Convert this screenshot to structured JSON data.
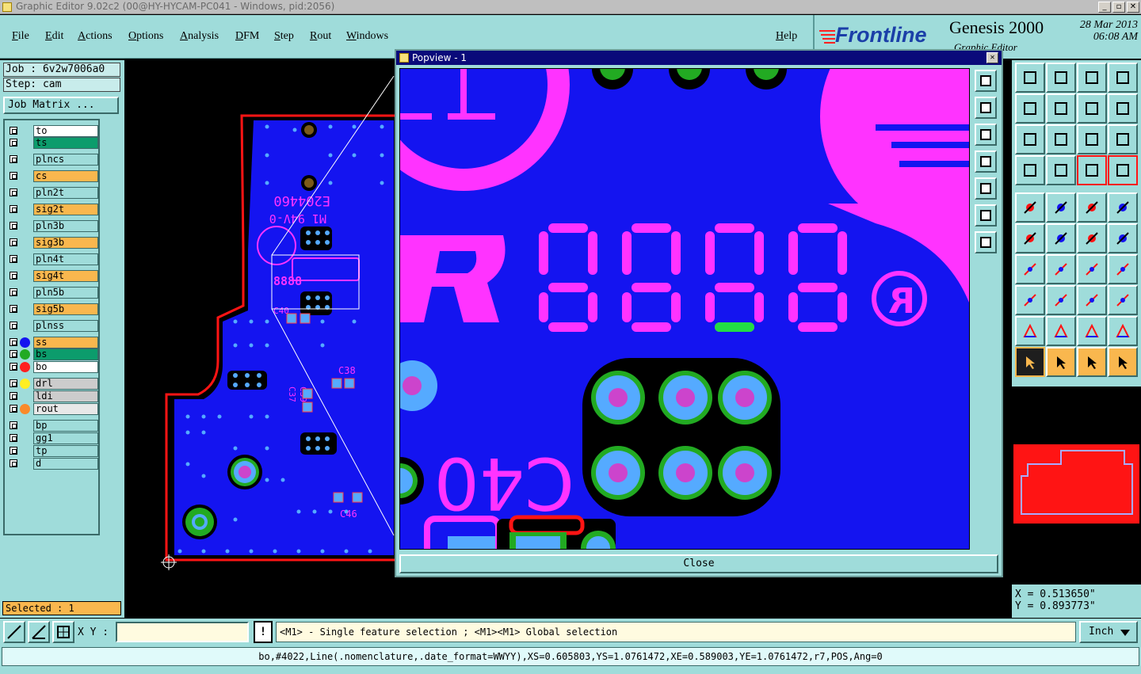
{
  "window": {
    "title": "Graphic Editor 9.02c2 (00@HY-HYCAM-PC041 - Windows, pid:2056)"
  },
  "menu": {
    "items": [
      "File",
      "Edit",
      "Actions",
      "Options",
      "Analysis",
      "DFM",
      "Step",
      "Rout",
      "Windows"
    ],
    "help": "Help"
  },
  "brand": {
    "logo": "Frontline",
    "product": "Genesis 2000",
    "subtitle": "Graphic Editor",
    "date": "28 Mar 2013",
    "time": "06:08 AM"
  },
  "job": {
    "job_label": "Job : 6v2w7006a0",
    "step_label": "Step: cam",
    "matrix_button": "Job Matrix ..."
  },
  "layers": [
    {
      "name": "to",
      "color": "#ffffff",
      "dot": null
    },
    {
      "name": "ts",
      "color": "#0c9c6c",
      "dot": null
    },
    {
      "name": "plncs",
      "color": "#9fdcda",
      "dot": null
    },
    {
      "name": "cs",
      "color": "#f9b74e",
      "dot": null
    },
    {
      "name": "pln2t",
      "color": "#9fdcda",
      "dot": null
    },
    {
      "name": "sig2t",
      "color": "#f9b74e",
      "dot": null
    },
    {
      "name": "pln3b",
      "color": "#9fdcda",
      "dot": null
    },
    {
      "name": "sig3b",
      "color": "#f9b74e",
      "dot": null
    },
    {
      "name": "pln4t",
      "color": "#9fdcda",
      "dot": null
    },
    {
      "name": "sig4t",
      "color": "#f9b74e",
      "dot": null
    },
    {
      "name": "pln5b",
      "color": "#9fdcda",
      "dot": null
    },
    {
      "name": "sig5b",
      "color": "#f9b74e",
      "dot": null
    },
    {
      "name": "plnss",
      "color": "#9fdcda",
      "dot": null
    },
    {
      "name": "ss",
      "color": "#f9b74e",
      "dot": "#1414f0"
    },
    {
      "name": "bs",
      "color": "#0c9c6c",
      "dot": "#22aa22"
    },
    {
      "name": "bo",
      "color": "#ffffff",
      "dot": "#ff2020"
    },
    {
      "name": "drl",
      "color": "#cccccc",
      "dot": "#ffee22"
    },
    {
      "name": "ldi",
      "color": "#cccccc",
      "dot": null
    },
    {
      "name": "rout",
      "color": "#e8e8e8",
      "dot": "#f98a2a"
    },
    {
      "name": "bp",
      "color": "#9fdcda",
      "dot": null
    },
    {
      "name": "gg1",
      "color": "#9fdcda",
      "dot": null
    },
    {
      "name": "tp",
      "color": "#9fdcda",
      "dot": null
    },
    {
      "name": "d",
      "color": "#9fdcda",
      "dot": null
    }
  ],
  "selection": {
    "label": "Selected : 1"
  },
  "popview": {
    "title": "Popview - 1",
    "close_label": "Close"
  },
  "coords": {
    "x": "X = 0.513650\"",
    "y": "Y = 0.893773\""
  },
  "bottom": {
    "xy_label": "X Y :",
    "xy_value": "",
    "bang": "!",
    "hint": "<M1> - Single feature selection ; <M1><M1> Global selection",
    "unit": "Inch",
    "status": "bo,#4022,Line(.nomenclature,.date_format=WWYY),XS=0.605803,YS=1.0761472,XE=0.589003,YE=1.0761472,r7,POS,Ang=0"
  },
  "board_text": {
    "code": "E204460",
    "rating": "M1 94V-0",
    "c40": "C40",
    "c38": "C38",
    "c46": "C46",
    "c37": "C37",
    "c39": "C39",
    "seg": "8888",
    "big_c40": "C40",
    "r_mark": "R"
  },
  "colors": {
    "accent": "#9fdcda",
    "board": "#1414f0",
    "silk": "#ff33ff",
    "outline": "#ff1414",
    "highlight": "#f9b74e"
  }
}
